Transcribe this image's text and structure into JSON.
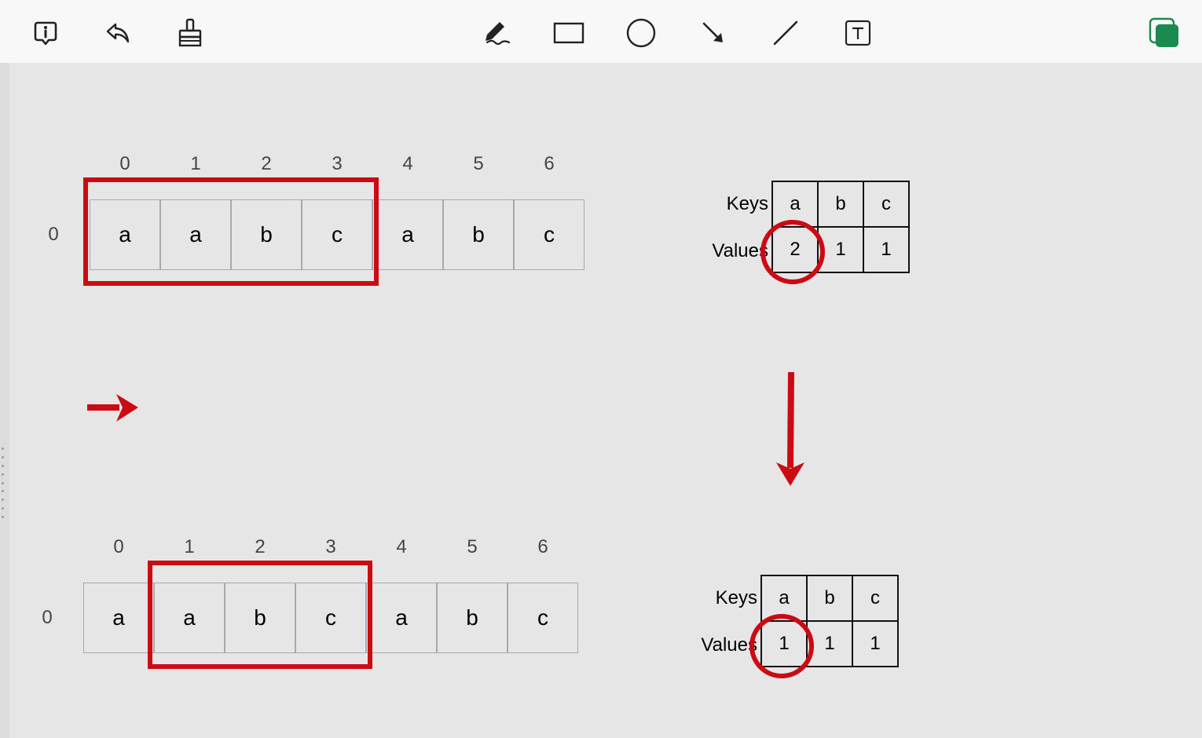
{
  "toolbar": {
    "left_tools": [
      {
        "name": "info-icon"
      },
      {
        "name": "undo-icon"
      },
      {
        "name": "clear-brush-icon"
      }
    ],
    "center_tools": [
      {
        "name": "pen-icon"
      },
      {
        "name": "rectangle-icon"
      },
      {
        "name": "circle-icon"
      },
      {
        "name": "arrow-icon"
      },
      {
        "name": "line-icon"
      },
      {
        "name": "text-box-icon"
      }
    ],
    "color_swatch": {
      "name": "color-swatch-icon",
      "color": "#1a8a4f"
    }
  },
  "colors": {
    "annotation_red": "#cc0a14",
    "grid_border": "#a8a8a8",
    "table_border": "#111111"
  },
  "diagram_top": {
    "row_label": "0",
    "indices": [
      "0",
      "1",
      "2",
      "3",
      "4",
      "5",
      "6"
    ],
    "cells": [
      "a",
      "a",
      "b",
      "c",
      "a",
      "b",
      "c"
    ],
    "window_start": 0,
    "window_end": 3
  },
  "diagram_bottom": {
    "row_label": "0",
    "indices": [
      "0",
      "1",
      "2",
      "3",
      "4",
      "5",
      "6"
    ],
    "cells": [
      "a",
      "a",
      "b",
      "c",
      "a",
      "b",
      "c"
    ],
    "window_start": 1,
    "window_end": 3
  },
  "table_top": {
    "keys_label": "Keys",
    "values_label": "Values",
    "keys": [
      "a",
      "b",
      "c"
    ],
    "values": [
      "2",
      "1",
      "1"
    ],
    "circled_index": 0
  },
  "table_bottom": {
    "keys_label": "Keys",
    "values_label": "Values",
    "keys": [
      "a",
      "b",
      "c"
    ],
    "values": [
      "1",
      "1",
      "1"
    ],
    "circled_index": 0
  }
}
